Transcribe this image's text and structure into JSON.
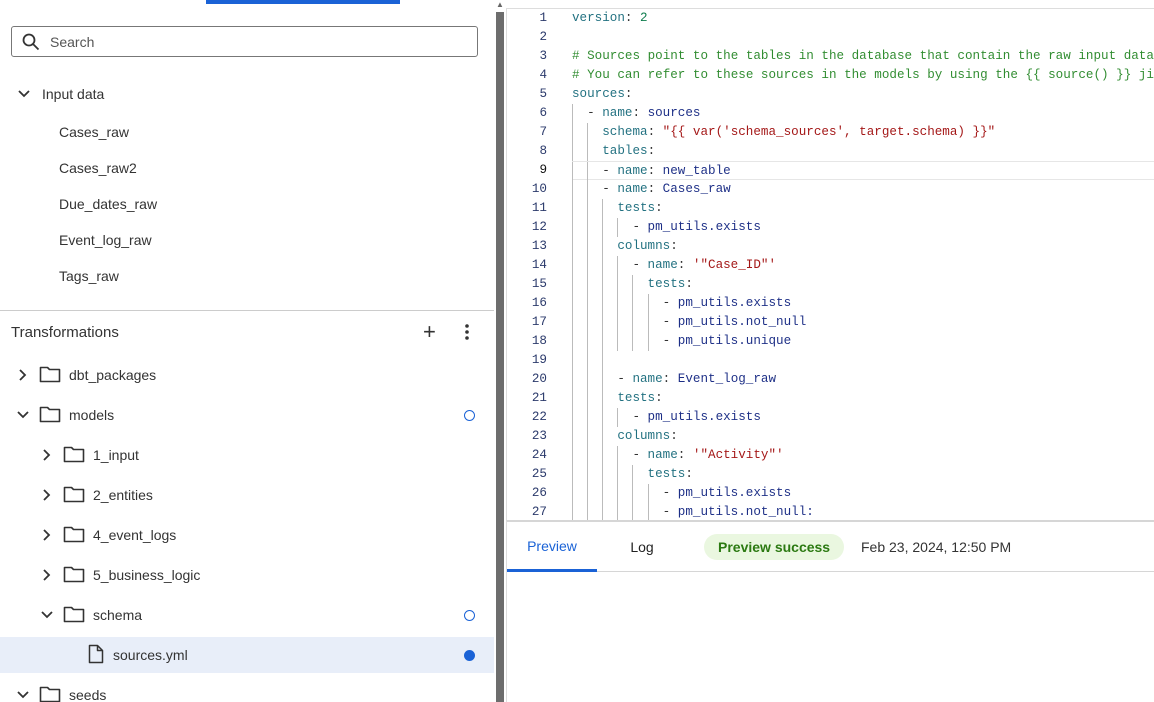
{
  "colors": {
    "accent": "#1a62d6",
    "success_bg": "#eaf7e0",
    "success_text": "#2c7a12",
    "selected_row": "#e8eef9"
  },
  "search": {
    "placeholder": "Search",
    "icon": "search-icon"
  },
  "input_data": {
    "label": "Input data",
    "items": [
      "Cases_raw",
      "Cases_raw2",
      "Due_dates_raw",
      "Event_log_raw",
      "Tags_raw"
    ]
  },
  "transformations": {
    "label": "Transformations",
    "add_icon": "plus-icon",
    "menu_icon": "kebab-icon",
    "tree": [
      {
        "label": "dbt_packages",
        "type": "folder",
        "level": 0,
        "expanded": false,
        "status": ""
      },
      {
        "label": "models",
        "type": "folder",
        "level": 0,
        "expanded": true,
        "status": "modified"
      },
      {
        "label": "1_input",
        "type": "folder",
        "level": 1,
        "expanded": false,
        "status": ""
      },
      {
        "label": "2_entities",
        "type": "folder",
        "level": 1,
        "expanded": false,
        "status": ""
      },
      {
        "label": "4_event_logs",
        "type": "folder",
        "level": 1,
        "expanded": false,
        "status": ""
      },
      {
        "label": "5_business_logic",
        "type": "folder",
        "level": 1,
        "expanded": false,
        "status": ""
      },
      {
        "label": "schema",
        "type": "folder",
        "level": 1,
        "expanded": true,
        "status": "modified"
      },
      {
        "label": "sources.yml",
        "type": "file",
        "level": 2,
        "selected": true,
        "status": "unsaved"
      },
      {
        "label": "seeds",
        "type": "folder",
        "level": 0,
        "expanded": true,
        "status": ""
      }
    ]
  },
  "editor": {
    "current_line": 9,
    "lines": [
      {
        "g": 0,
        "t": "version: 2"
      },
      {
        "g": 0,
        "t": ""
      },
      {
        "g": 0,
        "t": "# Sources point to the tables in the database that contain the raw input data"
      },
      {
        "g": 0,
        "t": "# You can refer to these sources in the models by using the {{ source() }} jinja"
      },
      {
        "g": 0,
        "t": "sources:"
      },
      {
        "g": 1,
        "t": "- name: sources"
      },
      {
        "g": 2,
        "t": "schema: \"{{ var('schema_sources', target.schema) }}\""
      },
      {
        "g": 2,
        "t": "tables:"
      },
      {
        "g": 2,
        "t": "- name: new_table"
      },
      {
        "g": 2,
        "t": "- name: Cases_raw"
      },
      {
        "g": 3,
        "t": "tests:"
      },
      {
        "g": 4,
        "t": "- pm_utils.exists"
      },
      {
        "g": 3,
        "t": "columns:"
      },
      {
        "g": 4,
        "t": "- name: '\"Case_ID\"'"
      },
      {
        "g": 5,
        "t": "tests:"
      },
      {
        "g": 6,
        "t": "- pm_utils.exists"
      },
      {
        "g": 6,
        "t": "- pm_utils.not_null"
      },
      {
        "g": 6,
        "t": "- pm_utils.unique"
      },
      {
        "g": 3,
        "t": ""
      },
      {
        "g": 3,
        "t": "- name: Event_log_raw"
      },
      {
        "g": 3,
        "t": "tests:"
      },
      {
        "g": 4,
        "t": "- pm_utils.exists"
      },
      {
        "g": 3,
        "t": "columns:"
      },
      {
        "g": 4,
        "t": "- name: '\"Activity\"'"
      },
      {
        "g": 5,
        "t": "tests:"
      },
      {
        "g": 6,
        "t": "- pm_utils.exists"
      },
      {
        "g": 6,
        "t": "- pm_utils.not_null:"
      }
    ]
  },
  "bottom": {
    "tabs": [
      "Preview",
      "Log"
    ],
    "active_tab": "Preview",
    "status": "Preview success",
    "timestamp": "Feb 23, 2024, 12:50 PM"
  }
}
